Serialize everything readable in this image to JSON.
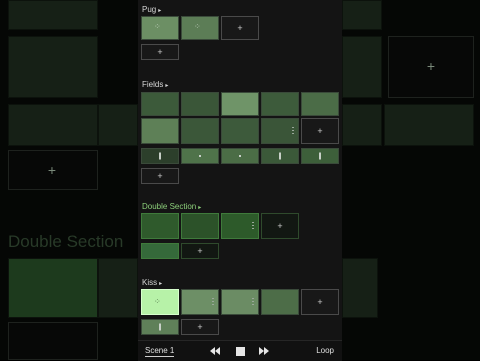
{
  "sections": {
    "pug": {
      "label": "Pug"
    },
    "fields": {
      "label": "Fields"
    },
    "double_section": {
      "label": "Double Section"
    },
    "kiss": {
      "label": "Kiss"
    }
  },
  "add_symbol": "+",
  "background": {
    "ghost_title": "Double Section"
  },
  "transport": {
    "scene_label": "Scene 1",
    "loop_label": "Loop",
    "rewind_icon": "rewind-icon",
    "stop_icon": "stop-icon",
    "forward_icon": "fast-forward-icon"
  },
  "colors": {
    "panel_bg": "#141414",
    "active_green": "#b7f2a8",
    "section_highlight": "#8ccf7a"
  }
}
